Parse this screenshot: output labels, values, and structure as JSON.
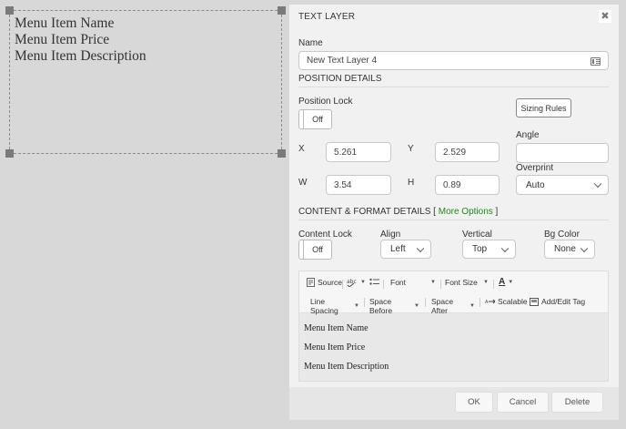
{
  "canvas": {
    "lines": [
      "Menu Item Name",
      "Menu Item Price",
      "Menu Item Description"
    ]
  },
  "panel": {
    "title": "TEXT LAYER",
    "close": "✖",
    "name_label": "Name",
    "name_value": "New Text Layer 4",
    "position_section": "POSITION DETAILS",
    "position_lock_label": "Position Lock",
    "position_lock_state": "Off",
    "sizing_rules": "Sizing Rules",
    "angle_label": "Angle",
    "angle_value": "",
    "x_label": "X",
    "x_value": "5.261",
    "y_label": "Y",
    "y_value": "2.529",
    "w_label": "W",
    "w_value": "3.54",
    "h_label": "H",
    "h_value": "0.89",
    "overprint_label": "Overprint",
    "overprint_value": "Auto",
    "content_section": "CONTENT & FORMAT DETAILS [ ",
    "more_options": "More Options",
    "content_section_end": " ]",
    "content_lock_label": "Content Lock",
    "content_lock_state": "Off",
    "align_label": "Align",
    "align_value": "Left",
    "vertical_label": "Vertical",
    "vertical_value": "Top",
    "bgcolor_label": "Bg Color",
    "bgcolor_value": "None"
  },
  "toolbar": {
    "source": "Source",
    "font": "Font",
    "font_size": "Font Size",
    "font_color": "A",
    "line_spacing": "Line Spacing",
    "space_before": "Space Before",
    "space_after": "Space After",
    "scalable": "Scalable",
    "add_edit_tag": "Add/Edit Tag"
  },
  "editor": {
    "lines": [
      "Menu Item Name",
      "Menu Item Price",
      "Menu Item Description"
    ]
  },
  "footer": {
    "ok": "OK",
    "cancel": "Cancel",
    "delete": "Delete"
  }
}
